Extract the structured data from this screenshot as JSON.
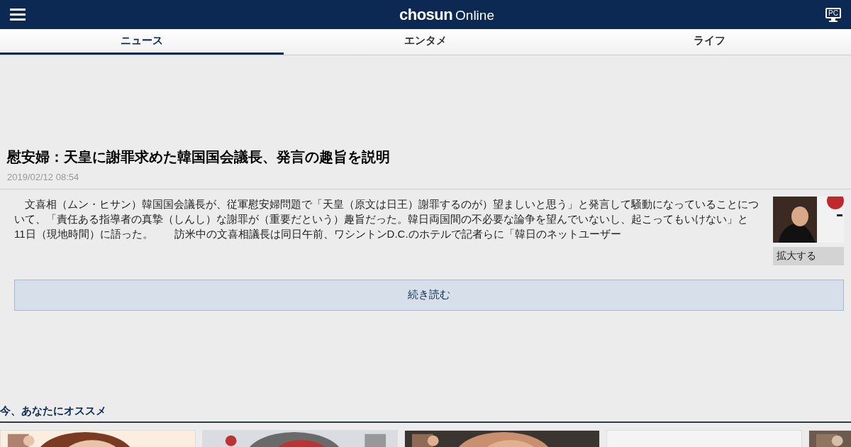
{
  "header": {
    "logo_bold": "chosun",
    "logo_light": "Online",
    "pc_label": "PC"
  },
  "tabs": [
    {
      "label": "ニュース",
      "selected": true
    },
    {
      "label": "エンタメ",
      "selected": false
    },
    {
      "label": "ライフ",
      "selected": false
    }
  ],
  "article": {
    "title": "慰安婦：天皇に謝罪求めた韓国国会議長、発言の趣旨を説明",
    "date": "2019/02/12 08:54",
    "body": "文喜相（ムン・ヒサン）韓国国会議長が、従軍慰安婦問題で「天皇（原文は日王）謝罪するのが）望ましいと思う」と発言して騒動になっていることについて、「責任ある指導者の真摯（しんし）な謝罪が（重要だという）趣旨だった。韓日両国間の不必要な論争を望んでいないし、起こってもいけない」と11日（現地時間）に語った。　　訪米中の文喜相議長は同日午前、ワシントンD.C.のホテルで記者らに「韓日のネットユーザー",
    "photo": {
      "kind": "picture"
    },
    "enlarge": "拡大する",
    "read_more": "続き読む"
  },
  "recommend": {
    "heading": "今、あなたにオススメ",
    "cards": [
      {
        "kind": "picture"
      },
      {
        "kind": "picture"
      },
      {
        "kind": "picture"
      },
      {
        "kind": "blank"
      },
      {
        "kind": "picture"
      }
    ]
  }
}
